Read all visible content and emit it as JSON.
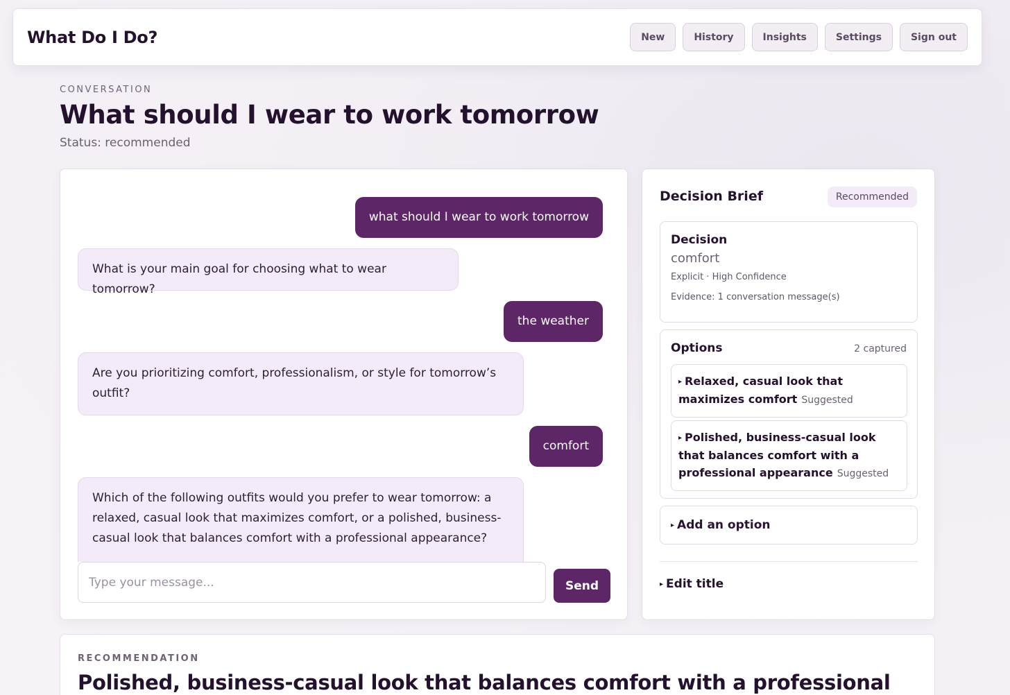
{
  "app": {
    "brand": "What Do I Do?"
  },
  "nav": {
    "items": [
      "New",
      "History",
      "Insights",
      "Settings",
      "Sign out"
    ]
  },
  "conversation": {
    "eyebrow": "CONVERSATION",
    "title": "What should I wear to work tomorrow",
    "status": "Status: recommended"
  },
  "messages": [
    {
      "role": "user",
      "text": "what should I wear to work tomorrow"
    },
    {
      "role": "assistant",
      "text": "What is your main goal for choosing what to wear tomorrow?"
    },
    {
      "role": "user",
      "text": "the weather"
    },
    {
      "role": "assistant",
      "text": "Are you prioritizing comfort, professionalism, or style for tomorrow’s outfit?"
    },
    {
      "role": "user",
      "text": "comfort"
    },
    {
      "role": "assistant",
      "text": "Which of the following outfits would you prefer to wear tomorrow: a relaxed, casual look that maximizes comfort, or a polished, business-casual look that balances comfort with a professional appearance?"
    }
  ],
  "composer": {
    "placeholder": "Type your message...",
    "send_label": "Send"
  },
  "brief": {
    "title": "Decision Brief",
    "badge": "Recommended",
    "decision": {
      "label": "Decision",
      "value": "comfort",
      "meta": "Explicit · High Confidence",
      "evidence": "Evidence: 1 conversation message(s)"
    },
    "options": {
      "label": "Options",
      "count": "2 captured",
      "items": [
        {
          "text": "Relaxed, casual look that maximizes comfort",
          "tag": "Suggested"
        },
        {
          "text": "Polished, business-casual look that balances comfort with a professional appearance",
          "tag": "Suggested"
        }
      ]
    },
    "add_option": "Add an option",
    "edit_title": "Edit title"
  },
  "recommendation": {
    "eyebrow": "RECOMMENDATION",
    "title": "Polished, business-casual look that balances comfort with a professional"
  },
  "colors": {
    "accent": "#5c2667",
    "bubble_bg": "#f3ecf8",
    "page_bg": "#f4f1f6"
  }
}
